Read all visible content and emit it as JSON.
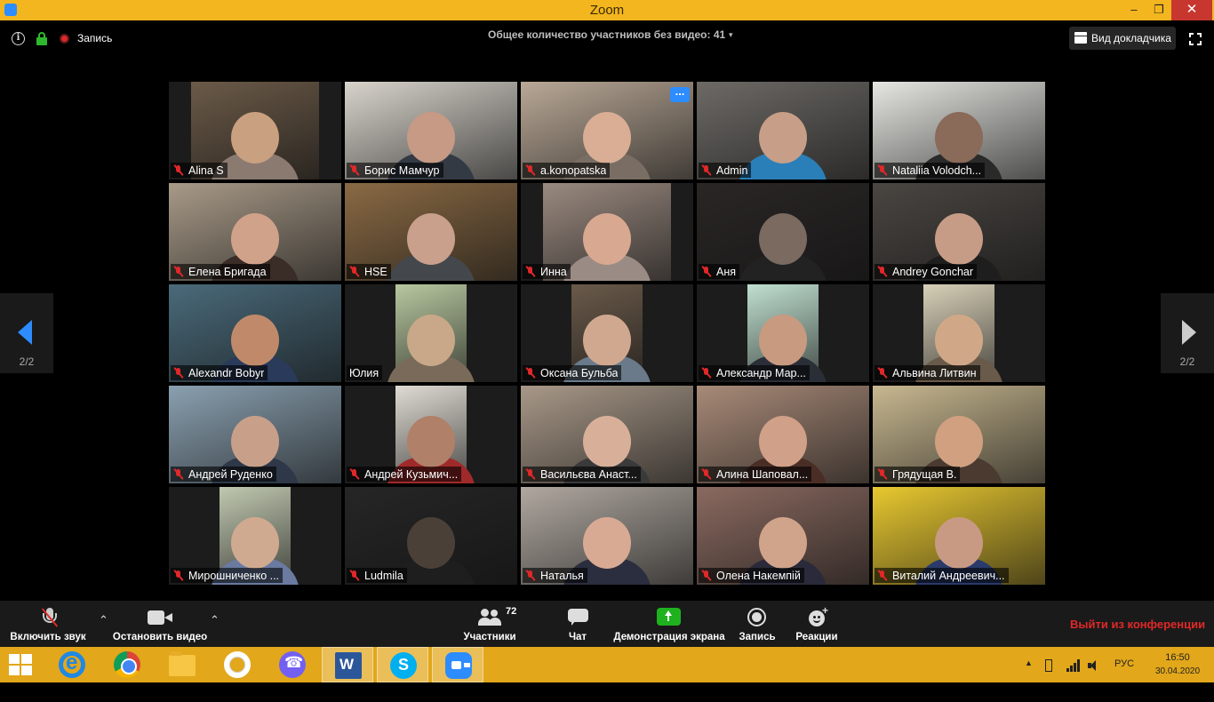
{
  "window": {
    "title": "Zoom",
    "minimize": "–",
    "maximize": "❐",
    "close": "✕"
  },
  "topbar": {
    "record_label": "Запись",
    "no_video_text": "Общее количество участников без видео: 41",
    "no_video_caret": "▾",
    "speaker_view_label": "Вид докладчика"
  },
  "pager": {
    "page_label": "2/2"
  },
  "participants": [
    {
      "name": "Alina S",
      "muted": true,
      "bg": "#6b5a48",
      "face": "#c9a080",
      "body": "#8a7a70"
    },
    {
      "name": "Борис Мамчур",
      "muted": true,
      "bg": "#d8d4cc",
      "face": "#c69a85",
      "body": "#333a44"
    },
    {
      "name": "a.konopatska",
      "muted": true,
      "bg": "#b9a896",
      "face": "#d9ae95",
      "body": "#7a6e64"
    },
    {
      "name": "Admin",
      "muted": true,
      "bg": "#6d6a66",
      "face": "#c79e87",
      "body": "#2b7fb8"
    },
    {
      "name": "Nataliia Volodch...",
      "muted": true,
      "bg": "#e6e6e2",
      "face": "#8a6a58",
      "body": "#2a2a2a"
    },
    {
      "name": "Елена Бригада",
      "muted": true,
      "bg": "#a89a88",
      "face": "#d0a28a",
      "body": "#3a2c26"
    },
    {
      "name": "HSE",
      "muted": true,
      "bg": "#8a6a44",
      "face": "#c8a08c",
      "body": "#44484c"
    },
    {
      "name": "Инна",
      "muted": true,
      "bg": "#9a8a80",
      "face": "#d8a890",
      "body": "#9a8c84"
    },
    {
      "name": "Аня",
      "muted": true,
      "bg": "#2a2626",
      "face": "#7a6a60",
      "body": "#222"
    },
    {
      "name": "Andrey Gonchar",
      "muted": true,
      "bg": "#4a4642",
      "face": "#c69c86",
      "body": "#1e1e1e"
    },
    {
      "name": "Alexandr Bobyr",
      "muted": true,
      "bg": "#4a6a7a",
      "face": "#c08a6a",
      "body": "#2a3a5a"
    },
    {
      "name": "Юлия",
      "muted": false,
      "bg": "#b8c8a0",
      "face": "#c8a888",
      "body": "#7a6a5a"
    },
    {
      "name": "Оксана Бульба",
      "muted": true,
      "bg": "#6a5a4a",
      "face": "#d0a890",
      "body": "#6a7a8a"
    },
    {
      "name": "Александр Мар...",
      "muted": true,
      "bg": "#c0e0d0",
      "face": "#c89a80",
      "body": "#2a2e36"
    },
    {
      "name": "Альвина Литвин",
      "muted": true,
      "bg": "#d8d0b8",
      "face": "#d0a888",
      "body": "#6a5a4a"
    },
    {
      "name": "Андрей Руденко",
      "muted": true,
      "bg": "#8aa0b0",
      "face": "#c8a08a",
      "body": "#2e3848"
    },
    {
      "name": "Андрей Кузьмич...",
      "muted": true,
      "bg": "#e0dcd4",
      "face": "#b08068",
      "body": "#a02a2a"
    },
    {
      "name": "Васильєва Анаст...",
      "muted": true,
      "bg": "#a89888",
      "face": "#d8b09a",
      "body": "#3a3a3a"
    },
    {
      "name": "Алина Шаповал...",
      "muted": true,
      "bg": "#a88a78",
      "face": "#d0a088",
      "body": "#4a2e26"
    },
    {
      "name": "Грядущая В.",
      "muted": true,
      "bg": "#c8b890",
      "face": "#d0a080",
      "body": "#4a3a30"
    },
    {
      "name": "Мирошниченко ...",
      "muted": true,
      "bg": "#c0c8b0",
      "face": "#d0aa90",
      "body": "#6a7aa0"
    },
    {
      "name": "Ludmila",
      "muted": true,
      "bg": "#262626",
      "face": "#4a4038",
      "body": "#1e1e1e"
    },
    {
      "name": "Наталья",
      "muted": true,
      "bg": "#b0a8a0",
      "face": "#d8aa94",
      "body": "#2a2e3e"
    },
    {
      "name": "Олена Накемпій",
      "muted": true,
      "bg": "#8a6a60",
      "face": "#d0a48a",
      "body": "#2a2a3a"
    },
    {
      "name": "Виталий Андреевич...",
      "muted": true,
      "bg": "#e8c830",
      "face": "#c89a84",
      "body": "#2a3a6a"
    }
  ],
  "toolbar": {
    "unmute_label": "Включить звук",
    "stop_video_label": "Остановить видео",
    "participants_label": "Участники",
    "participants_count": "72",
    "chat_label": "Чат",
    "share_label": "Демонстрация экрана",
    "record_label": "Запись",
    "reactions_label": "Реакции",
    "caret": "⌃",
    "leave_label": "Выйти из конференции"
  },
  "taskbar": {
    "apps": [
      "windows-start",
      "internet-explorer",
      "chrome",
      "file-explorer",
      "opera",
      "viber",
      "word",
      "skype",
      "zoom"
    ],
    "lang": "РУС",
    "time": "16:50",
    "date": "30.04.2020",
    "tray_caret": "▲"
  },
  "colors": {
    "accent": "#2d8cff",
    "titlebar": "#f3b61e",
    "taskbar": "#e2a71a",
    "danger": "#e02828",
    "share": "#1fb21f"
  }
}
